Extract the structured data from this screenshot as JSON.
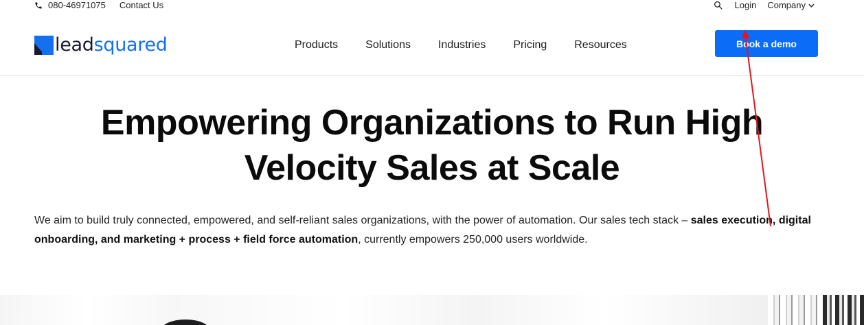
{
  "topbar": {
    "phone": "080-46971075",
    "contact": "Contact Us",
    "login": "Login",
    "company": "Company"
  },
  "logo": {
    "part1": "lead",
    "part2": "squared",
    "colors": {
      "dark": "#1a1a2e",
      "accent": "#1570ef"
    }
  },
  "nav": {
    "items": [
      {
        "label": "Products"
      },
      {
        "label": "Solutions"
      },
      {
        "label": "Industries"
      },
      {
        "label": "Pricing"
      },
      {
        "label": "Resources"
      }
    ]
  },
  "cta": {
    "label": "Book a demo",
    "color": "#0a6cf7"
  },
  "hero": {
    "title_line1": "Empowering Organizations to Run High",
    "title_line2": "Velocity Sales at Scale",
    "desc_part1": "We aim to build truly connected, empowered, and self-reliant sales organizations, with the power of automation. Our sales tech stack – ",
    "desc_bold": "sales execution, digital onboarding, and marketing + process + field force automation",
    "desc_part2": ", currently empowers 250,000 users worldwide."
  },
  "icons": {
    "phone": "phone-icon",
    "search": "search-icon",
    "chevron": "chevron-down-icon"
  },
  "annotation": {
    "color": "#e8141b"
  }
}
